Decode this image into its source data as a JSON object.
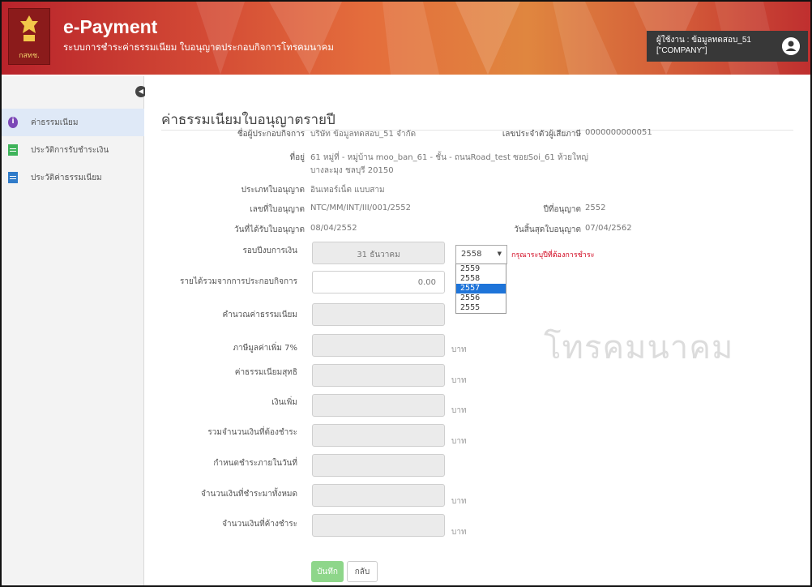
{
  "header": {
    "app_title": "e-Payment",
    "app_subtitle": "ระบบการชำระค่าธรรมเนียม ใบอนุญาตประกอบกิจการโทรคมนาคม",
    "logo_caption": "กสทช.",
    "user_label": "ผู้ใช้งาน : ข้อมูลทดสอบ_51",
    "user_role": "[\"COMPANY\"]"
  },
  "sidebar": {
    "items": [
      {
        "label": "ค่าธรรมเนียม",
        "icon": "info-icon",
        "active": true
      },
      {
        "label": "ประวัติการรับชำระเงิน",
        "icon": "document-icon"
      },
      {
        "label": "ประวัติค่าธรรมเนียม",
        "icon": "document-icon"
      }
    ]
  },
  "main": {
    "title": "ค่าธรรมเนียมใบอนุญาตรายปี",
    "info": {
      "operator_label": "ชื่อผู้ประกอบกิจการ",
      "operator_value": "บริษัท ข้อมูลทดสอบ_51 จำกัด",
      "taxid_label": "เลขประจำตัวผู้เสียภาษี",
      "taxid_value": "0000000000051",
      "address_label": "ที่อยู่",
      "address_line1": "61 หมู่ที่ - หมู่บ้าน moo_ban_61 - ชั้น - ถนนRoad_test ซอยSoi_61 ห้วยใหญ่",
      "address_line2": "บางละมุง ชลบุรี 20150",
      "license_type_label": "ประเภทใบอนุญาต",
      "license_type_value": "อินเทอร์เน็ต แบบสาม",
      "license_no_label": "เลขที่ใบอนุญาต",
      "license_no_value": "NTC/MM/INT/III/001/2552",
      "license_year_label": "ปีที่อนุญาต",
      "license_year_value": "2552",
      "issue_date_label": "วันที่ได้รับใบอนุญาต",
      "issue_date_value": "08/04/2552",
      "expiry_date_label": "วันสิ้นสุดใบอนุญาต",
      "expiry_date_value": "07/04/2562"
    },
    "form": {
      "fiscal_label": "รอบปีงบการเงิน",
      "fiscal_value": "31 ธันวาคม",
      "year_selected": "2558",
      "year_hint": "กรุณาระบุปีที่ต้องการชำระ",
      "year_options": [
        "2559",
        "2558",
        "2557",
        "2556",
        "2555"
      ],
      "year_highlighted_index": 2,
      "income_label": "รายได้รวมจากการประกอบกิจการ",
      "income_value": "0.00",
      "fee_calc_label": "คำนวณค่าธรรมเนียม",
      "vat_label": "ภาษีมูลค่าเพิ่ม 7%",
      "net_fee_label": "ค่าธรรมเนียมสุทธิ",
      "surcharge_label": "เงินเพิ่ม",
      "total_due_label": "รวมจำนวนเงินที่ต้องชำระ",
      "due_date_label": "กำหนดชำระภายในวันที่",
      "paid_total_label": "จำนวนเงินที่ชำระมาทั้งหมด",
      "outstanding_label": "จำนวนเงินที่ค้างชำระ",
      "unit": "บาท"
    },
    "watermark": "โทรคมนาคม",
    "buttons": {
      "save": "บันทึก",
      "back": "กลับ"
    }
  }
}
